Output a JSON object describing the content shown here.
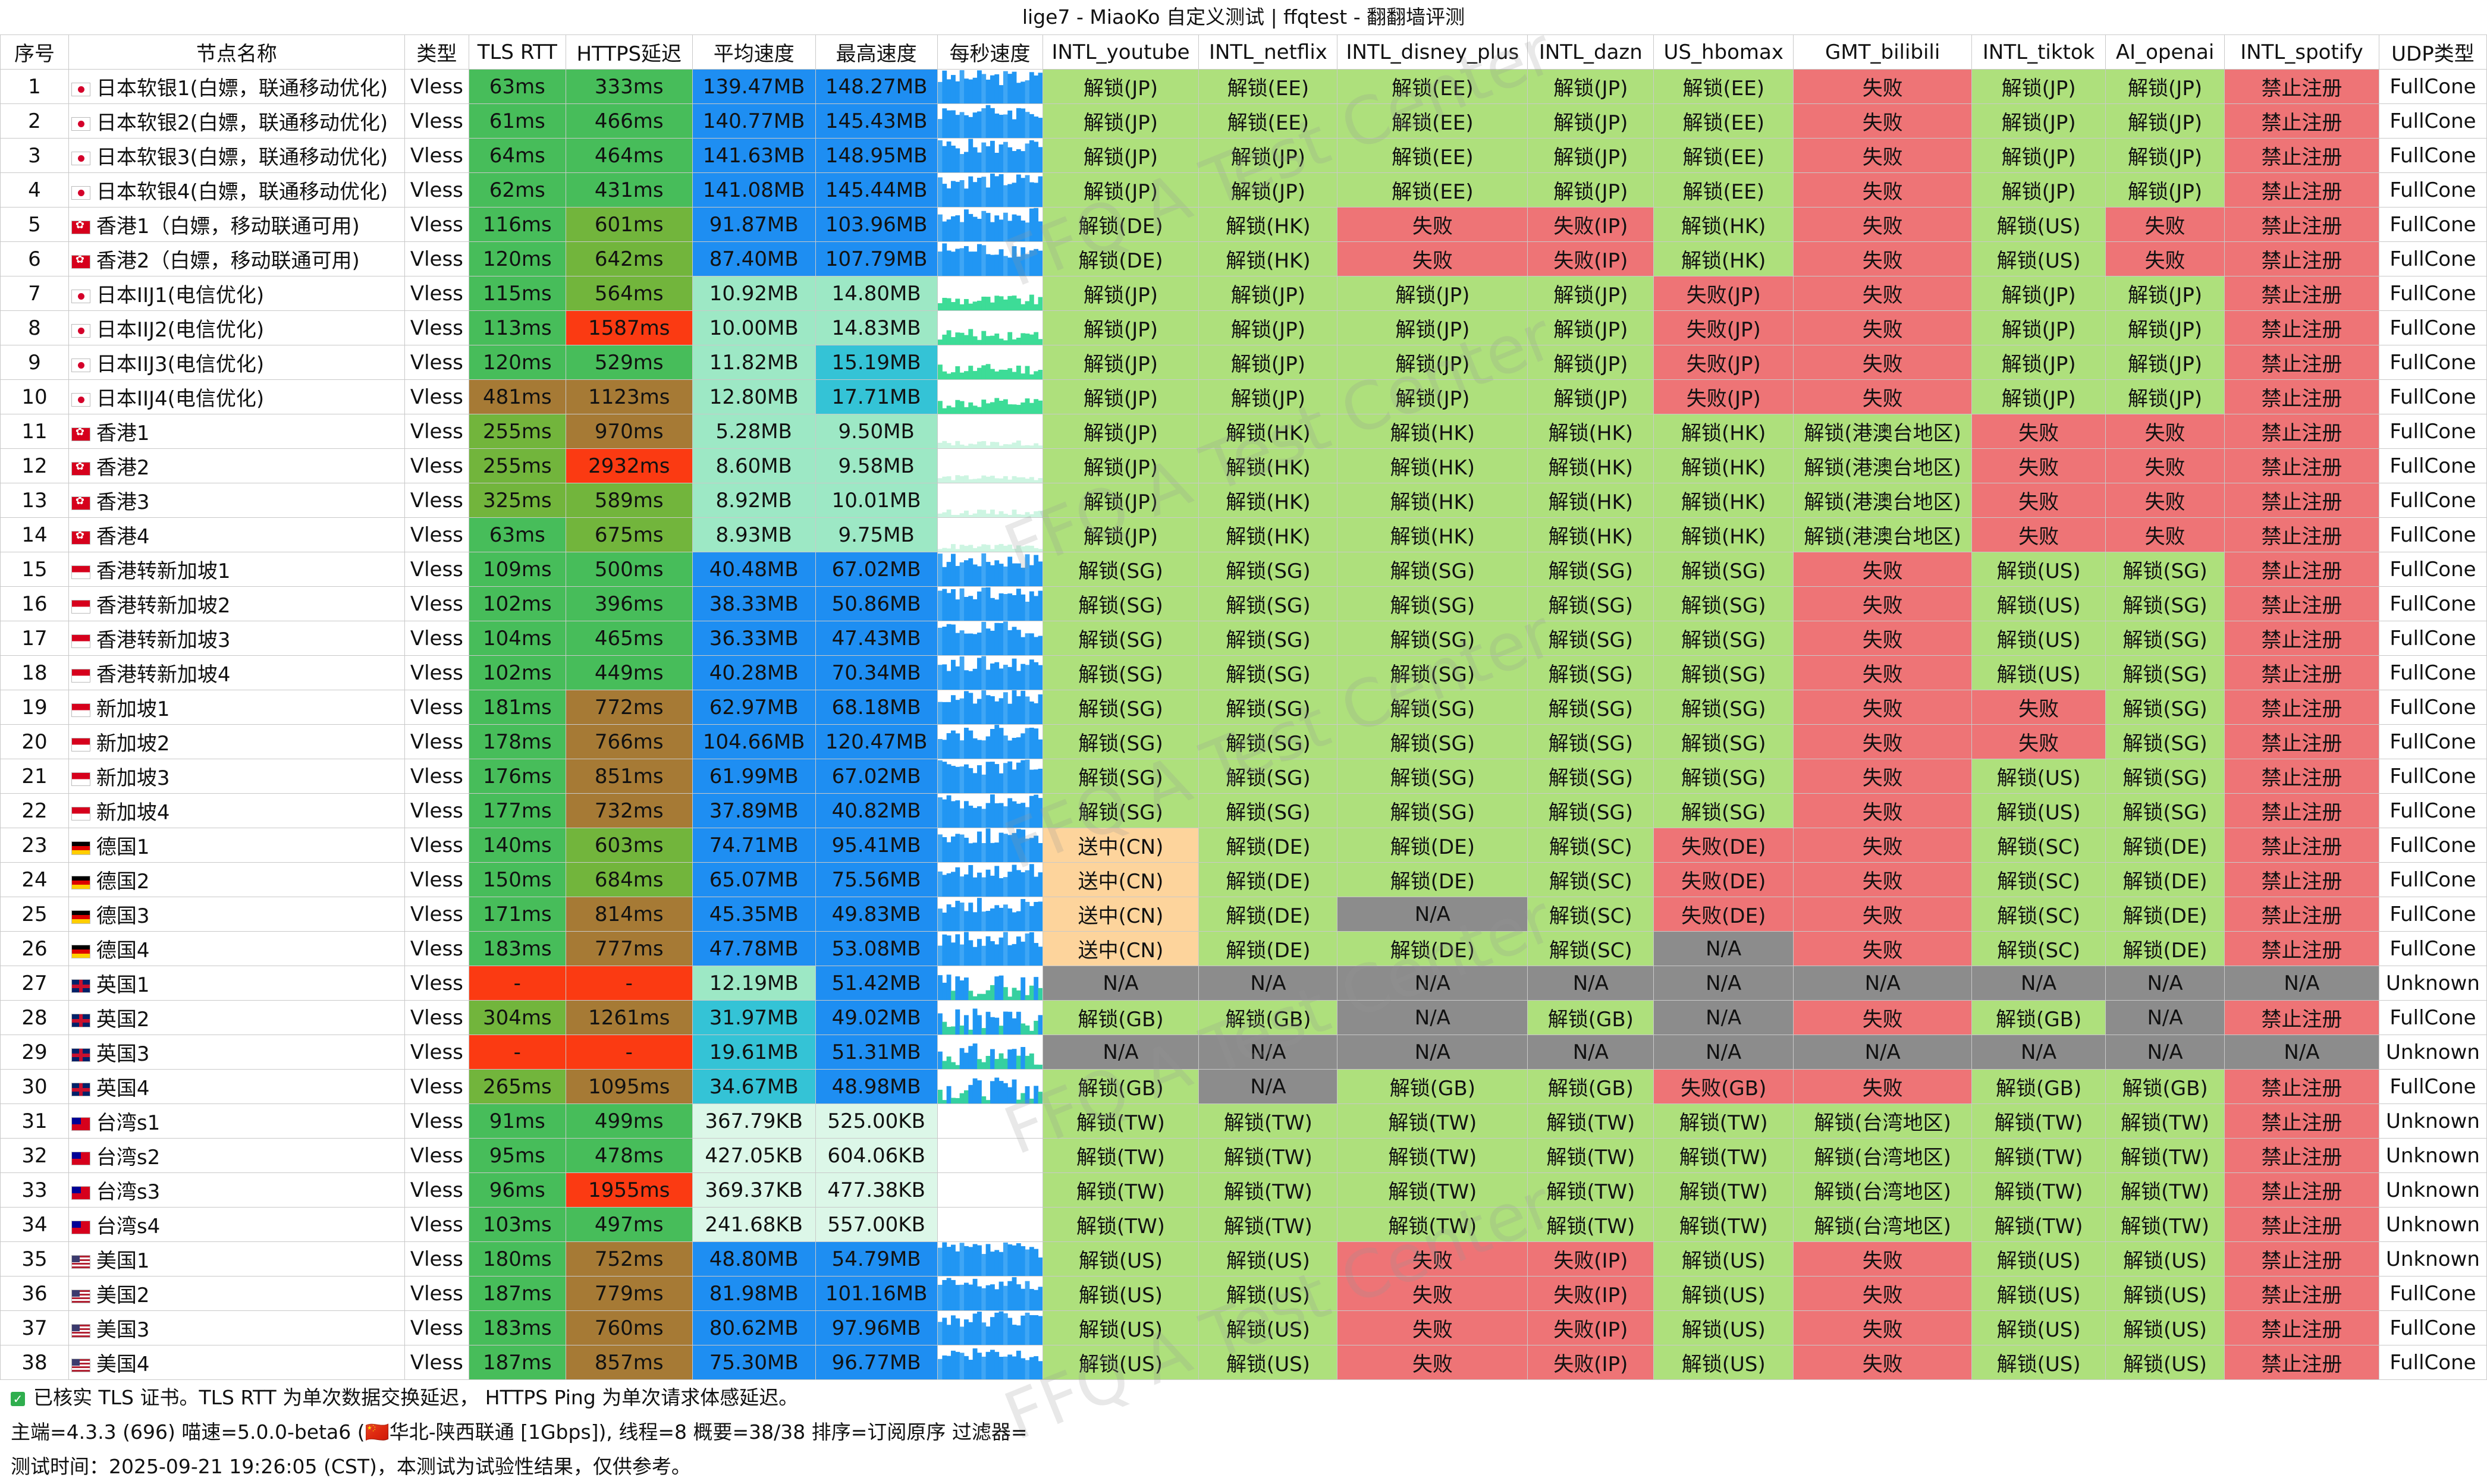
{
  "title": "lige7 - MiaoKo 自定义测试 | ffqtest - 翻翻墙评测",
  "headers": [
    "序号",
    "节点名称",
    "类型",
    "TLS RTT",
    "HTTPS延迟",
    "平均速度",
    "最高速度",
    "每秒速度",
    "INTL_youtube",
    "INTL_netflix",
    "INTL_disney_plus",
    "INTL_dazn",
    "US_hbomax",
    "GMT_bilibili",
    "INTL_tiktok",
    "AI_openai",
    "INTL_spotify",
    "UDP类型"
  ],
  "colors": {
    "green": "#aee07c",
    "red": "#ee7476",
    "gray": "#8c8c8c",
    "orange": "#fdd49c",
    "tls_green": "#47bd5a",
    "https_olive": "#72b53c",
    "https_brown": "#a67a35",
    "https_red": "#fb3a12",
    "speed_blue": "#1e8ef2",
    "speed_cyan": "#34c3d6",
    "speed_light": "#9de8c5",
    "speed_pale": "#dcf7e8"
  },
  "rows": [
    {
      "no": "1",
      "flag": "jp",
      "name": "日本软银1(白嫖，联通移动优化)",
      "type": "Vless",
      "tls": "63ms",
      "https": "333ms",
      "avg": "139.47MB",
      "max": "148.27MB",
      "spark": "blue",
      "yt": "解锁(JP)",
      "nf": "解锁(EE)",
      "dp": "解锁(EE)",
      "dazn": "解锁(JP)",
      "hbo": "解锁(EE)",
      "bili": "失败",
      "tt": "解锁(JP)",
      "ai": "解锁(JP)",
      "sp": "禁止注册",
      "udp": "FullCone"
    },
    {
      "no": "2",
      "flag": "jp",
      "name": "日本软银2(白嫖，联通移动优化)",
      "type": "Vless",
      "tls": "61ms",
      "https": "466ms",
      "avg": "140.77MB",
      "max": "145.43MB",
      "spark": "blue",
      "yt": "解锁(JP)",
      "nf": "解锁(EE)",
      "dp": "解锁(EE)",
      "dazn": "解锁(JP)",
      "hbo": "解锁(EE)",
      "bili": "失败",
      "tt": "解锁(JP)",
      "ai": "解锁(JP)",
      "sp": "禁止注册",
      "udp": "FullCone"
    },
    {
      "no": "3",
      "flag": "jp",
      "name": "日本软银3(白嫖，联通移动优化)",
      "type": "Vless",
      "tls": "64ms",
      "https": "464ms",
      "avg": "141.63MB",
      "max": "148.95MB",
      "spark": "blue",
      "yt": "解锁(JP)",
      "nf": "解锁(JP)",
      "dp": "解锁(EE)",
      "dazn": "解锁(JP)",
      "hbo": "解锁(EE)",
      "bili": "失败",
      "tt": "解锁(JP)",
      "ai": "解锁(JP)",
      "sp": "禁止注册",
      "udp": "FullCone"
    },
    {
      "no": "4",
      "flag": "jp",
      "name": "日本软银4(白嫖，联通移动优化)",
      "type": "Vless",
      "tls": "62ms",
      "https": "431ms",
      "avg": "141.08MB",
      "max": "145.44MB",
      "spark": "blue",
      "yt": "解锁(JP)",
      "nf": "解锁(JP)",
      "dp": "解锁(EE)",
      "dazn": "解锁(JP)",
      "hbo": "解锁(EE)",
      "bili": "失败",
      "tt": "解锁(JP)",
      "ai": "解锁(JP)",
      "sp": "禁止注册",
      "udp": "FullCone"
    },
    {
      "no": "5",
      "flag": "hk",
      "name": "香港1（白嫖，移动联通可用)",
      "type": "Vless",
      "tls": "116ms",
      "https": "601ms",
      "avg": "91.87MB",
      "max": "103.96MB",
      "spark": "blue",
      "yt": "解锁(DE)",
      "nf": "解锁(HK)",
      "dp": "失败",
      "dazn": "失败(IP)",
      "hbo": "解锁(HK)",
      "bili": "失败",
      "tt": "解锁(US)",
      "ai": "失败",
      "sp": "禁止注册",
      "udp": "FullCone"
    },
    {
      "no": "6",
      "flag": "hk",
      "name": "香港2（白嫖，移动联通可用)",
      "type": "Vless",
      "tls": "120ms",
      "https": "642ms",
      "avg": "87.40MB",
      "max": "107.79MB",
      "spark": "blue",
      "yt": "解锁(DE)",
      "nf": "解锁(HK)",
      "dp": "失败",
      "dazn": "失败(IP)",
      "hbo": "解锁(HK)",
      "bili": "失败",
      "tt": "解锁(US)",
      "ai": "失败",
      "sp": "禁止注册",
      "udp": "FullCone"
    },
    {
      "no": "7",
      "flag": "jp",
      "name": "日本IIJ1(电信优化)",
      "type": "Vless",
      "tls": "115ms",
      "https": "564ms",
      "avg": "10.92MB",
      "max": "14.80MB",
      "spark": "green",
      "yt": "解锁(JP)",
      "nf": "解锁(JP)",
      "dp": "解锁(JP)",
      "dazn": "解锁(JP)",
      "hbo": "失败(JP)",
      "bili": "失败",
      "tt": "解锁(JP)",
      "ai": "解锁(JP)",
      "sp": "禁止注册",
      "udp": "FullCone"
    },
    {
      "no": "8",
      "flag": "jp",
      "name": "日本IIJ2(电信优化)",
      "type": "Vless",
      "tls": "113ms",
      "https": "1587ms",
      "avg": "10.00MB",
      "max": "14.83MB",
      "spark": "green",
      "yt": "解锁(JP)",
      "nf": "解锁(JP)",
      "dp": "解锁(JP)",
      "dazn": "解锁(JP)",
      "hbo": "失败(JP)",
      "bili": "失败",
      "tt": "解锁(JP)",
      "ai": "解锁(JP)",
      "sp": "禁止注册",
      "udp": "FullCone"
    },
    {
      "no": "9",
      "flag": "jp",
      "name": "日本IIJ3(电信优化)",
      "type": "Vless",
      "tls": "120ms",
      "https": "529ms",
      "avg": "11.82MB",
      "max": "15.19MB",
      "spark": "green",
      "yt": "解锁(JP)",
      "nf": "解锁(JP)",
      "dp": "解锁(JP)",
      "dazn": "解锁(JP)",
      "hbo": "失败(JP)",
      "bili": "失败",
      "tt": "解锁(JP)",
      "ai": "解锁(JP)",
      "sp": "禁止注册",
      "udp": "FullCone"
    },
    {
      "no": "10",
      "flag": "jp",
      "name": "日本IIJ4(电信优化)",
      "type": "Vless",
      "tls": "481ms",
      "https": "1123ms",
      "avg": "12.80MB",
      "max": "17.71MB",
      "spark": "green",
      "yt": "解锁(JP)",
      "nf": "解锁(JP)",
      "dp": "解锁(JP)",
      "dazn": "解锁(JP)",
      "hbo": "失败(JP)",
      "bili": "失败",
      "tt": "解锁(JP)",
      "ai": "解锁(JP)",
      "sp": "禁止注册",
      "udp": "FullCone"
    },
    {
      "no": "11",
      "flag": "hk",
      "name": "香港1",
      "type": "Vless",
      "tls": "255ms",
      "https": "970ms",
      "avg": "5.28MB",
      "max": "9.50MB",
      "spark": "pale",
      "yt": "解锁(JP)",
      "nf": "解锁(HK)",
      "dp": "解锁(HK)",
      "dazn": "解锁(HK)",
      "hbo": "解锁(HK)",
      "bili": "解锁(港澳台地区)",
      "tt": "失败",
      "ai": "失败",
      "sp": "禁止注册",
      "udp": "FullCone"
    },
    {
      "no": "12",
      "flag": "hk",
      "name": "香港2",
      "type": "Vless",
      "tls": "255ms",
      "https": "2932ms",
      "avg": "8.60MB",
      "max": "9.58MB",
      "spark": "pale",
      "yt": "解锁(JP)",
      "nf": "解锁(HK)",
      "dp": "解锁(HK)",
      "dazn": "解锁(HK)",
      "hbo": "解锁(HK)",
      "bili": "解锁(港澳台地区)",
      "tt": "失败",
      "ai": "失败",
      "sp": "禁止注册",
      "udp": "FullCone"
    },
    {
      "no": "13",
      "flag": "hk",
      "name": "香港3",
      "type": "Vless",
      "tls": "325ms",
      "https": "589ms",
      "avg": "8.92MB",
      "max": "10.01MB",
      "spark": "pale",
      "yt": "解锁(JP)",
      "nf": "解锁(HK)",
      "dp": "解锁(HK)",
      "dazn": "解锁(HK)",
      "hbo": "解锁(HK)",
      "bili": "解锁(港澳台地区)",
      "tt": "失败",
      "ai": "失败",
      "sp": "禁止注册",
      "udp": "FullCone"
    },
    {
      "no": "14",
      "flag": "hk",
      "name": "香港4",
      "type": "Vless",
      "tls": "63ms",
      "https": "675ms",
      "avg": "8.93MB",
      "max": "9.75MB",
      "spark": "pale",
      "yt": "解锁(JP)",
      "nf": "解锁(HK)",
      "dp": "解锁(HK)",
      "dazn": "解锁(HK)",
      "hbo": "解锁(HK)",
      "bili": "解锁(港澳台地区)",
      "tt": "失败",
      "ai": "失败",
      "sp": "禁止注册",
      "udp": "FullCone"
    },
    {
      "no": "15",
      "flag": "sg",
      "name": "香港转新加坡1",
      "type": "Vless",
      "tls": "109ms",
      "https": "500ms",
      "avg": "40.48MB",
      "max": "67.02MB",
      "spark": "blue",
      "yt": "解锁(SG)",
      "nf": "解锁(SG)",
      "dp": "解锁(SG)",
      "dazn": "解锁(SG)",
      "hbo": "解锁(SG)",
      "bili": "失败",
      "tt": "解锁(US)",
      "ai": "解锁(SG)",
      "sp": "禁止注册",
      "udp": "FullCone"
    },
    {
      "no": "16",
      "flag": "sg",
      "name": "香港转新加坡2",
      "type": "Vless",
      "tls": "102ms",
      "https": "396ms",
      "avg": "38.33MB",
      "max": "50.86MB",
      "spark": "blue",
      "yt": "解锁(SG)",
      "nf": "解锁(SG)",
      "dp": "解锁(SG)",
      "dazn": "解锁(SG)",
      "hbo": "解锁(SG)",
      "bili": "失败",
      "tt": "解锁(US)",
      "ai": "解锁(SG)",
      "sp": "禁止注册",
      "udp": "FullCone"
    },
    {
      "no": "17",
      "flag": "sg",
      "name": "香港转新加坡3",
      "type": "Vless",
      "tls": "104ms",
      "https": "465ms",
      "avg": "36.33MB",
      "max": "47.43MB",
      "spark": "blue",
      "yt": "解锁(SG)",
      "nf": "解锁(SG)",
      "dp": "解锁(SG)",
      "dazn": "解锁(SG)",
      "hbo": "解锁(SG)",
      "bili": "失败",
      "tt": "解锁(US)",
      "ai": "解锁(SG)",
      "sp": "禁止注册",
      "udp": "FullCone"
    },
    {
      "no": "18",
      "flag": "sg",
      "name": "香港转新加坡4",
      "type": "Vless",
      "tls": "102ms",
      "https": "449ms",
      "avg": "40.28MB",
      "max": "70.34MB",
      "spark": "blue",
      "yt": "解锁(SG)",
      "nf": "解锁(SG)",
      "dp": "解锁(SG)",
      "dazn": "解锁(SG)",
      "hbo": "解锁(SG)",
      "bili": "失败",
      "tt": "解锁(US)",
      "ai": "解锁(SG)",
      "sp": "禁止注册",
      "udp": "FullCone"
    },
    {
      "no": "19",
      "flag": "sg",
      "name": "新加坡1",
      "type": "Vless",
      "tls": "181ms",
      "https": "772ms",
      "avg": "62.97MB",
      "max": "68.18MB",
      "spark": "blue",
      "yt": "解锁(SG)",
      "nf": "解锁(SG)",
      "dp": "解锁(SG)",
      "dazn": "解锁(SG)",
      "hbo": "解锁(SG)",
      "bili": "失败",
      "tt": "失败",
      "ai": "解锁(SG)",
      "sp": "禁止注册",
      "udp": "FullCone"
    },
    {
      "no": "20",
      "flag": "sg",
      "name": "新加坡2",
      "type": "Vless",
      "tls": "178ms",
      "https": "766ms",
      "avg": "104.66MB",
      "max": "120.47MB",
      "spark": "blue",
      "yt": "解锁(SG)",
      "nf": "解锁(SG)",
      "dp": "解锁(SG)",
      "dazn": "解锁(SG)",
      "hbo": "解锁(SG)",
      "bili": "失败",
      "tt": "失败",
      "ai": "解锁(SG)",
      "sp": "禁止注册",
      "udp": "FullCone"
    },
    {
      "no": "21",
      "flag": "sg",
      "name": "新加坡3",
      "type": "Vless",
      "tls": "176ms",
      "https": "851ms",
      "avg": "61.99MB",
      "max": "67.02MB",
      "spark": "blue",
      "yt": "解锁(SG)",
      "nf": "解锁(SG)",
      "dp": "解锁(SG)",
      "dazn": "解锁(SG)",
      "hbo": "解锁(SG)",
      "bili": "失败",
      "tt": "解锁(US)",
      "ai": "解锁(SG)",
      "sp": "禁止注册",
      "udp": "FullCone"
    },
    {
      "no": "22",
      "flag": "sg",
      "name": "新加坡4",
      "type": "Vless",
      "tls": "177ms",
      "https": "732ms",
      "avg": "37.89MB",
      "max": "40.82MB",
      "spark": "blue",
      "yt": "解锁(SG)",
      "nf": "解锁(SG)",
      "dp": "解锁(SG)",
      "dazn": "解锁(SG)",
      "hbo": "解锁(SG)",
      "bili": "失败",
      "tt": "解锁(US)",
      "ai": "解锁(SG)",
      "sp": "禁止注册",
      "udp": "FullCone"
    },
    {
      "no": "23",
      "flag": "de",
      "name": "德国1",
      "type": "Vless",
      "tls": "140ms",
      "https": "603ms",
      "avg": "74.71MB",
      "max": "95.41MB",
      "spark": "blue",
      "yt": "送中(CN)",
      "nf": "解锁(DE)",
      "dp": "解锁(DE)",
      "dazn": "解锁(SC)",
      "hbo": "失败(DE)",
      "bili": "失败",
      "tt": "解锁(SC)",
      "ai": "解锁(DE)",
      "sp": "禁止注册",
      "udp": "FullCone"
    },
    {
      "no": "24",
      "flag": "de",
      "name": "德国2",
      "type": "Vless",
      "tls": "150ms",
      "https": "684ms",
      "avg": "65.07MB",
      "max": "75.56MB",
      "spark": "blue",
      "yt": "送中(CN)",
      "nf": "解锁(DE)",
      "dp": "解锁(DE)",
      "dazn": "解锁(SC)",
      "hbo": "失败(DE)",
      "bili": "失败",
      "tt": "解锁(SC)",
      "ai": "解锁(DE)",
      "sp": "禁止注册",
      "udp": "FullCone"
    },
    {
      "no": "25",
      "flag": "de",
      "name": "德国3",
      "type": "Vless",
      "tls": "171ms",
      "https": "814ms",
      "avg": "45.35MB",
      "max": "49.83MB",
      "spark": "blue",
      "yt": "送中(CN)",
      "nf": "解锁(DE)",
      "dp": "N/A",
      "dazn": "解锁(SC)",
      "hbo": "失败(DE)",
      "bili": "失败",
      "tt": "解锁(SC)",
      "ai": "解锁(DE)",
      "sp": "禁止注册",
      "udp": "FullCone"
    },
    {
      "no": "26",
      "flag": "de",
      "name": "德国4",
      "type": "Vless",
      "tls": "183ms",
      "https": "777ms",
      "avg": "47.78MB",
      "max": "53.08MB",
      "spark": "blue",
      "yt": "送中(CN)",
      "nf": "解锁(DE)",
      "dp": "解锁(DE)",
      "dazn": "解锁(SC)",
      "hbo": "N/A",
      "bili": "失败",
      "tt": "解锁(SC)",
      "ai": "解锁(DE)",
      "sp": "禁止注册",
      "udp": "FullCone"
    },
    {
      "no": "27",
      "flag": "gb",
      "name": "英国1",
      "type": "Vless",
      "tls": "-",
      "https": "-",
      "avg": "12.19MB",
      "max": "51.42MB",
      "spark": "mixed",
      "yt": "N/A",
      "nf": "N/A",
      "dp": "N/A",
      "dazn": "N/A",
      "hbo": "N/A",
      "bili": "N/A",
      "tt": "N/A",
      "ai": "N/A",
      "sp": "N/A",
      "udp": "Unknown"
    },
    {
      "no": "28",
      "flag": "gb",
      "name": "英国2",
      "type": "Vless",
      "tls": "304ms",
      "https": "1261ms",
      "avg": "31.97MB",
      "max": "49.02MB",
      "spark": "mixed",
      "yt": "解锁(GB)",
      "nf": "解锁(GB)",
      "dp": "N/A",
      "dazn": "解锁(GB)",
      "hbo": "N/A",
      "bili": "失败",
      "tt": "解锁(GB)",
      "ai": "N/A",
      "sp": "禁止注册",
      "udp": "FullCone"
    },
    {
      "no": "29",
      "flag": "gb",
      "name": "英国3",
      "type": "Vless",
      "tls": "-",
      "https": "-",
      "avg": "19.61MB",
      "max": "51.31MB",
      "spark": "mixed",
      "yt": "N/A",
      "nf": "N/A",
      "dp": "N/A",
      "dazn": "N/A",
      "hbo": "N/A",
      "bili": "N/A",
      "tt": "N/A",
      "ai": "N/A",
      "sp": "N/A",
      "udp": "Unknown"
    },
    {
      "no": "30",
      "flag": "gb",
      "name": "英国4",
      "type": "Vless",
      "tls": "265ms",
      "https": "1095ms",
      "avg": "34.67MB",
      "max": "48.98MB",
      "spark": "mixed",
      "yt": "解锁(GB)",
      "nf": "N/A",
      "dp": "解锁(GB)",
      "dazn": "解锁(GB)",
      "hbo": "失败(GB)",
      "bili": "失败",
      "tt": "解锁(GB)",
      "ai": "解锁(GB)",
      "sp": "禁止注册",
      "udp": "FullCone"
    },
    {
      "no": "31",
      "flag": "tw",
      "name": "台湾s1",
      "type": "Vless",
      "tls": "91ms",
      "https": "499ms",
      "avg": "367.79KB",
      "max": "525.00KB",
      "spark": "none",
      "yt": "解锁(TW)",
      "nf": "解锁(TW)",
      "dp": "解锁(TW)",
      "dazn": "解锁(TW)",
      "hbo": "解锁(TW)",
      "bili": "解锁(台湾地区)",
      "tt": "解锁(TW)",
      "ai": "解锁(TW)",
      "sp": "禁止注册",
      "udp": "Unknown"
    },
    {
      "no": "32",
      "flag": "tw",
      "name": "台湾s2",
      "type": "Vless",
      "tls": "95ms",
      "https": "478ms",
      "avg": "427.05KB",
      "max": "604.06KB",
      "spark": "none",
      "yt": "解锁(TW)",
      "nf": "解锁(TW)",
      "dp": "解锁(TW)",
      "dazn": "解锁(TW)",
      "hbo": "解锁(TW)",
      "bili": "解锁(台湾地区)",
      "tt": "解锁(TW)",
      "ai": "解锁(TW)",
      "sp": "禁止注册",
      "udp": "Unknown"
    },
    {
      "no": "33",
      "flag": "tw",
      "name": "台湾s3",
      "type": "Vless",
      "tls": "96ms",
      "https": "1955ms",
      "avg": "369.37KB",
      "max": "477.38KB",
      "spark": "none",
      "yt": "解锁(TW)",
      "nf": "解锁(TW)",
      "dp": "解锁(TW)",
      "dazn": "解锁(TW)",
      "hbo": "解锁(TW)",
      "bili": "解锁(台湾地区)",
      "tt": "解锁(TW)",
      "ai": "解锁(TW)",
      "sp": "禁止注册",
      "udp": "Unknown"
    },
    {
      "no": "34",
      "flag": "tw",
      "name": "台湾s4",
      "type": "Vless",
      "tls": "103ms",
      "https": "497ms",
      "avg": "241.68KB",
      "max": "557.00KB",
      "spark": "none",
      "yt": "解锁(TW)",
      "nf": "解锁(TW)",
      "dp": "解锁(TW)",
      "dazn": "解锁(TW)",
      "hbo": "解锁(TW)",
      "bili": "解锁(台湾地区)",
      "tt": "解锁(TW)",
      "ai": "解锁(TW)",
      "sp": "禁止注册",
      "udp": "Unknown"
    },
    {
      "no": "35",
      "flag": "us",
      "name": "美国1",
      "type": "Vless",
      "tls": "180ms",
      "https": "752ms",
      "avg": "48.80MB",
      "max": "54.79MB",
      "spark": "blue",
      "yt": "解锁(US)",
      "nf": "解锁(US)",
      "dp": "失败",
      "dazn": "失败(IP)",
      "hbo": "解锁(US)",
      "bili": "失败",
      "tt": "解锁(US)",
      "ai": "解锁(US)",
      "sp": "禁止注册",
      "udp": "Unknown"
    },
    {
      "no": "36",
      "flag": "us",
      "name": "美国2",
      "type": "Vless",
      "tls": "187ms",
      "https": "779ms",
      "avg": "81.98MB",
      "max": "101.16MB",
      "spark": "blue",
      "yt": "解锁(US)",
      "nf": "解锁(US)",
      "dp": "失败",
      "dazn": "失败(IP)",
      "hbo": "解锁(US)",
      "bili": "失败",
      "tt": "解锁(US)",
      "ai": "解锁(US)",
      "sp": "禁止注册",
      "udp": "FullCone"
    },
    {
      "no": "37",
      "flag": "us",
      "name": "美国3",
      "type": "Vless",
      "tls": "183ms",
      "https": "760ms",
      "avg": "80.62MB",
      "max": "97.96MB",
      "spark": "blue",
      "yt": "解锁(US)",
      "nf": "解锁(US)",
      "dp": "失败",
      "dazn": "失败(IP)",
      "hbo": "解锁(US)",
      "bili": "失败",
      "tt": "解锁(US)",
      "ai": "解锁(US)",
      "sp": "禁止注册",
      "udp": "FullCone"
    },
    {
      "no": "38",
      "flag": "us",
      "name": "美国4",
      "type": "Vless",
      "tls": "187ms",
      "https": "857ms",
      "avg": "75.30MB",
      "max": "96.77MB",
      "spark": "blue",
      "yt": "解锁(US)",
      "nf": "解锁(US)",
      "dp": "失败",
      "dazn": "失败(IP)",
      "hbo": "解锁(US)",
      "bili": "失败",
      "tt": "解锁(US)",
      "ai": "解锁(US)",
      "sp": "禁止注册",
      "udp": "FullCone"
    }
  ],
  "footer": {
    "line1": "已核实 TLS 证书。TLS RTT 为单次数据交换延迟， HTTPS Ping 为单次请求体感延迟。",
    "line2": "主端=4.3.3 (696) 喵速=5.0.0-beta6 (🇨🇳华北-陕西联通 [1Gbps]), 线程=8 概要=38/38 排序=订阅原序 过滤器=",
    "line3": "测试时间：2025-09-21 19:26:05 (CST)，本测试为试验性结果，仅供参考。"
  },
  "watermark": "FFQ  A Test Center"
}
